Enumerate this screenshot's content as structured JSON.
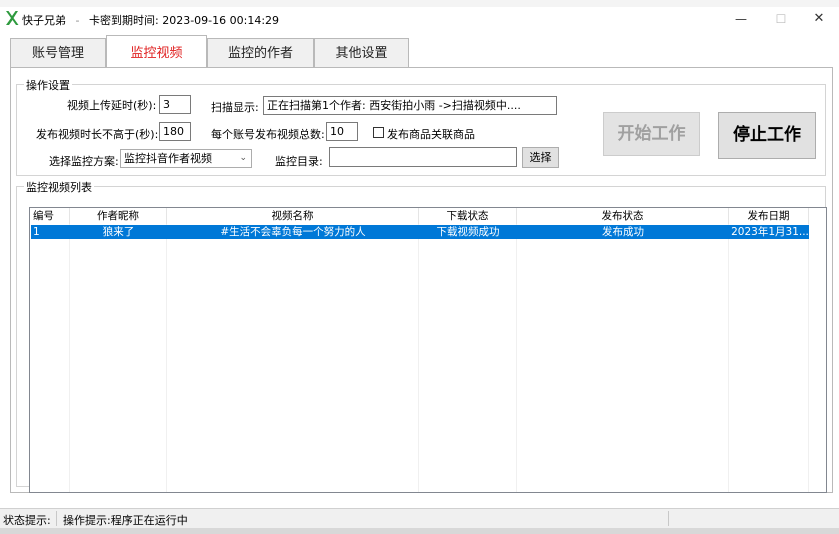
{
  "window": {
    "app_name": "快子兄弟",
    "separator": "-",
    "expire_label": "卡密到期时间:",
    "expire_time": "2023-09-16 00:14:29",
    "min_glyph": "—",
    "max_glyph": "☐",
    "close_glyph": "✕"
  },
  "tabs": [
    {
      "label": "账号管理",
      "active": false
    },
    {
      "label": "监控视频",
      "active": true
    },
    {
      "label": "监控的作者",
      "active": false
    },
    {
      "label": "其他设置",
      "active": false
    }
  ],
  "settings": {
    "group_title": "操作设置",
    "upload_delay_label": "视频上传延时(秒):",
    "upload_delay_value": "3",
    "scan_display_label": "扫描显示:",
    "scan_display_value": "正在扫描第1个作者: 西安街拍小雨 ->扫描视频中....",
    "max_duration_label": "发布视频时长不高于(秒):",
    "max_duration_value": "180",
    "per_account_label": "每个账号发布视频总数:",
    "per_account_value": "10",
    "publish_goods_label": "发布商品关联商品",
    "publish_goods_checked": false,
    "scheme_label": "选择监控方案:",
    "scheme_value": "监控抖音作者视频",
    "dir_label": "监控目录:",
    "dir_value": "",
    "select_button": "选择",
    "start_button": "开始工作",
    "stop_button": "停止工作"
  },
  "video_list": {
    "group_title": "监控视频列表",
    "columns": [
      "编号",
      "作者昵称",
      "视频名称",
      "下载状态",
      "发布状态",
      "发布日期"
    ],
    "rows": [
      {
        "id": "1",
        "author": "狼来了",
        "title": "#生活不会辜负每一个努力的人",
        "download_status": "下载视频成功",
        "publish_status": "发布成功",
        "publish_date": "2023年1月31..."
      }
    ],
    "selected_row_color": "#0078d7"
  },
  "status": {
    "state_label": "状态提示:",
    "op_label": "操作提示:",
    "op_value": "程序正在运行中"
  }
}
